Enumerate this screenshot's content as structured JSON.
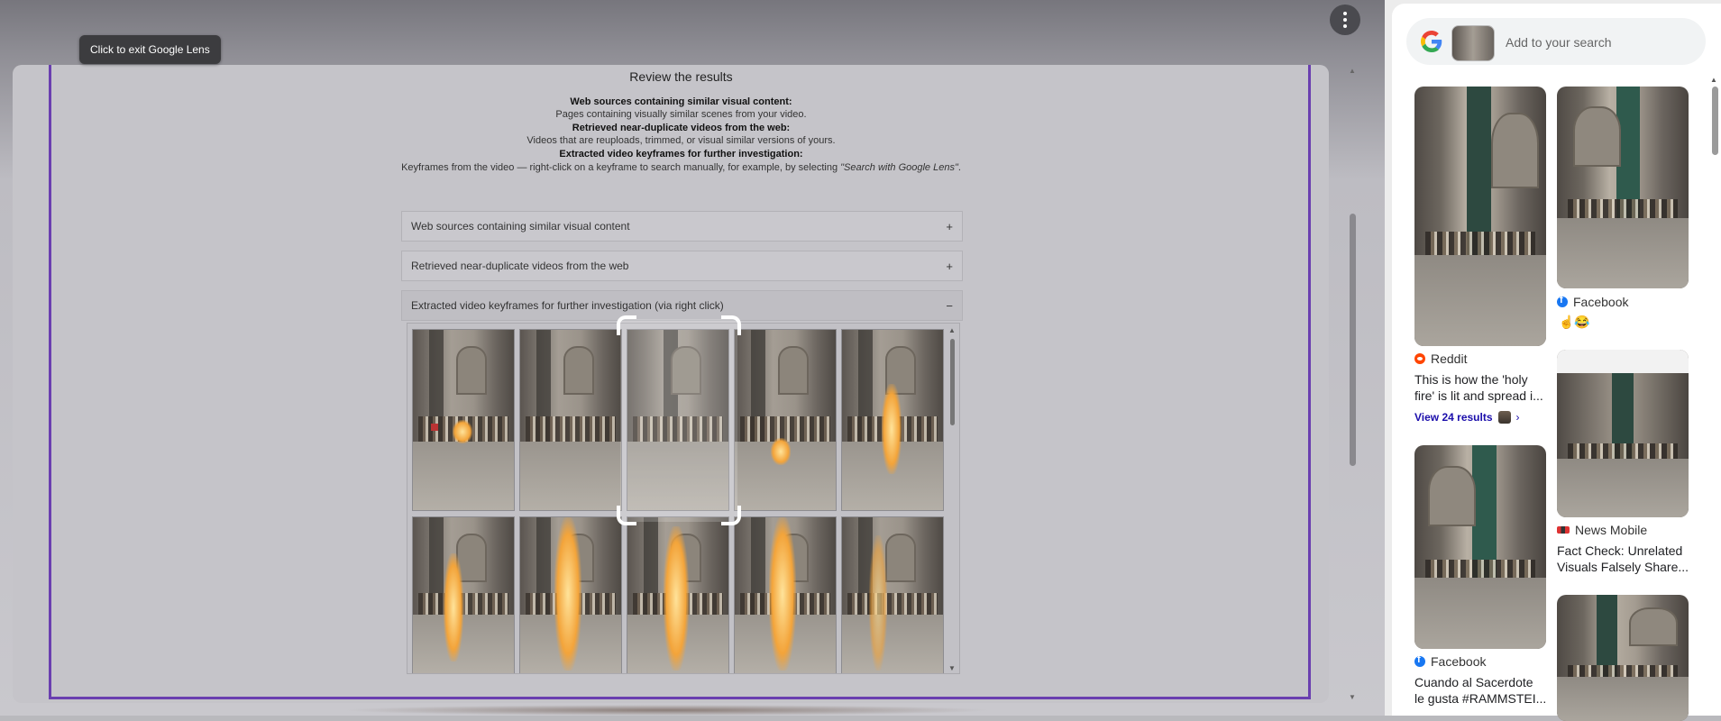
{
  "overlay": {
    "tooltip": "Click to exit Google Lens"
  },
  "page": {
    "title": "Review the results",
    "descriptions": [
      {
        "heading": "Web sources containing similar visual content:",
        "text": "Pages containing visually similar scenes from your video."
      },
      {
        "heading": "Retrieved near-duplicate videos from the web:",
        "text": "Videos that are reuploads, trimmed, or visual similar versions of yours."
      },
      {
        "heading": "Extracted video keyframes for further investigation:",
        "text": "Keyframes from the video — right-click on a keyframe to search manually, for example, by selecting ",
        "emphasis": "\"Search with Google Lens\"",
        "end": "."
      }
    ],
    "accordions": [
      {
        "label": "Web sources containing similar visual content",
        "toggle": "+"
      },
      {
        "label": "Retrieved near-duplicate videos from the web",
        "toggle": "+"
      },
      {
        "label": "Extracted video keyframes for further investigation (via right click)",
        "toggle": "−"
      }
    ]
  },
  "lens": {
    "search_placeholder": "Add to your search",
    "results": [
      {
        "source": "Reddit",
        "title_line1": "This is how the 'holy",
        "title_line2": "fire' is lit and spread i...",
        "view_more": "View 24 results"
      },
      {
        "source": "Facebook",
        "emoji": "☝️😂"
      },
      {
        "source": "News Mobile",
        "title_line1": "Fact Check: Unrelated",
        "title_line2": "Visuals Falsely Share..."
      },
      {
        "source": "Facebook",
        "title_line1": "Cuando al Sacerdote",
        "title_line2": "le gusta #RAMMSTEI..."
      }
    ]
  },
  "colors": {
    "frame_purple": "#6a3fb0",
    "link_blue": "#1a0dab",
    "facebook_blue": "#1877f2",
    "reddit_orange": "#ff4500"
  }
}
